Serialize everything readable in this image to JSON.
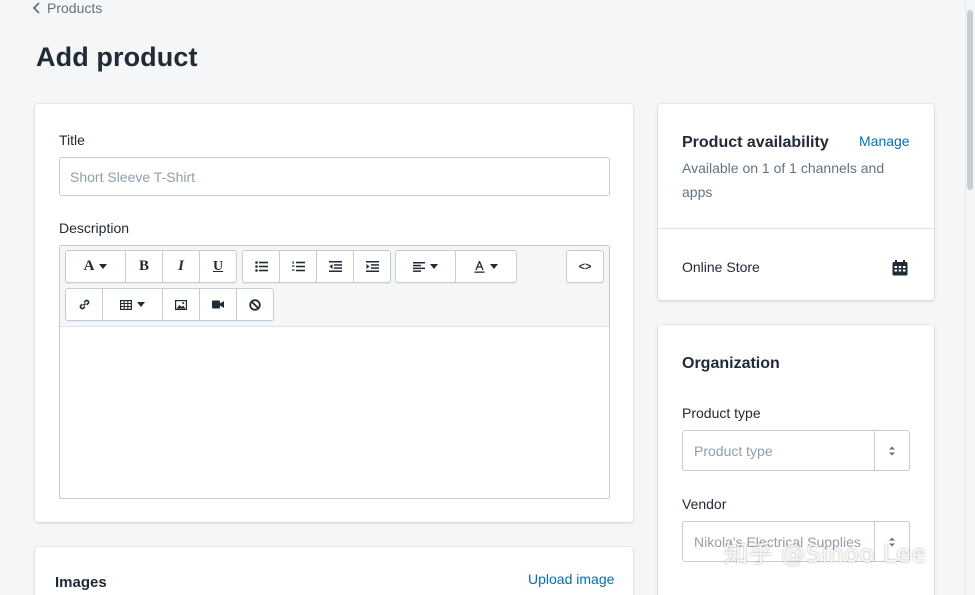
{
  "breadcrumb": {
    "label": "Products"
  },
  "page": {
    "title": "Add product"
  },
  "product": {
    "title_label": "Title",
    "title_placeholder": "Short Sleeve T-Shirt",
    "description_label": "Description",
    "toolbar": {
      "font_button": "A",
      "bold": "B",
      "italic": "I",
      "underline": "U",
      "html_toggle": "<>"
    }
  },
  "images": {
    "heading": "Images",
    "upload_link": "Upload image"
  },
  "availability": {
    "heading": "Product availability",
    "manage_link": "Manage",
    "summary": "Available on 1 of 1 channels and apps",
    "channel": "Online Store"
  },
  "organization": {
    "heading": "Organization",
    "product_type_label": "Product type",
    "product_type_placeholder": "Product type",
    "vendor_label": "Vendor",
    "vendor_placeholder": "Nikola's Electrical Supplies"
  },
  "watermark": "知乎 @Sinoo Lee",
  "icons": [
    "chevron-left-icon",
    "font-icon",
    "bold-icon",
    "italic-icon",
    "underline-icon",
    "bullet-list-icon",
    "numbered-list-icon",
    "outdent-icon",
    "indent-icon",
    "align-left-icon",
    "text-color-icon",
    "code-icon",
    "link-icon",
    "table-icon",
    "image-icon",
    "video-icon",
    "clear-format-icon",
    "calendar-icon",
    "select-arrows-icon"
  ],
  "colors": {
    "accent": "#006fbb",
    "background": "#f4f6f8",
    "text": "#212b36",
    "subdued": "#637381"
  }
}
